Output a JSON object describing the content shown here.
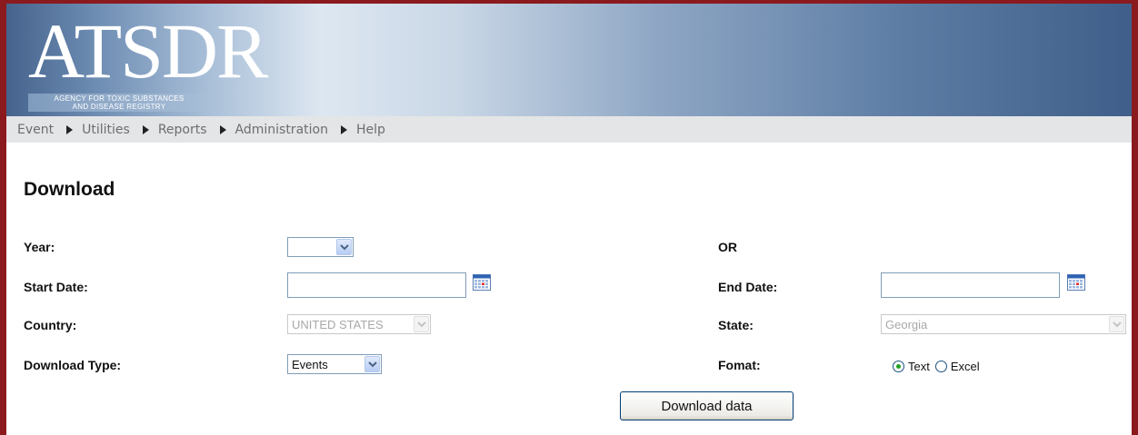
{
  "header": {
    "logo_text": "ATSDR",
    "logo_subtitle_line1": "AGENCY FOR TOXIC SUBSTANCES",
    "logo_subtitle_line2": "AND DISEASE REGISTRY"
  },
  "menu": [
    {
      "label": "Event"
    },
    {
      "label": "Utilities"
    },
    {
      "label": "Reports"
    },
    {
      "label": "Administration"
    },
    {
      "label": "Help"
    }
  ],
  "page_title": "Download",
  "form": {
    "year_label": "Year:",
    "year_value": "",
    "or_label": "OR",
    "start_date_label": "Start Date:",
    "start_date_value": "",
    "end_date_label": "End Date:",
    "end_date_value": "",
    "country_label": "Country:",
    "country_value": "UNITED STATES",
    "state_label": "State:",
    "state_value": "Georgia",
    "download_type_label": "Download Type:",
    "download_type_value": "Events",
    "format_label": "Fomat:",
    "format_options": [
      "Text",
      "Excel"
    ],
    "format_selected": "Text",
    "download_button_label": "Download data"
  },
  "icons": {
    "calendar": "calendar-icon",
    "dropdown": "chevron-down-icon"
  },
  "colors": {
    "frame": "#8b1a1e",
    "banner_dark": "#3f5f8a",
    "menu_bg": "#e4e5e6"
  }
}
